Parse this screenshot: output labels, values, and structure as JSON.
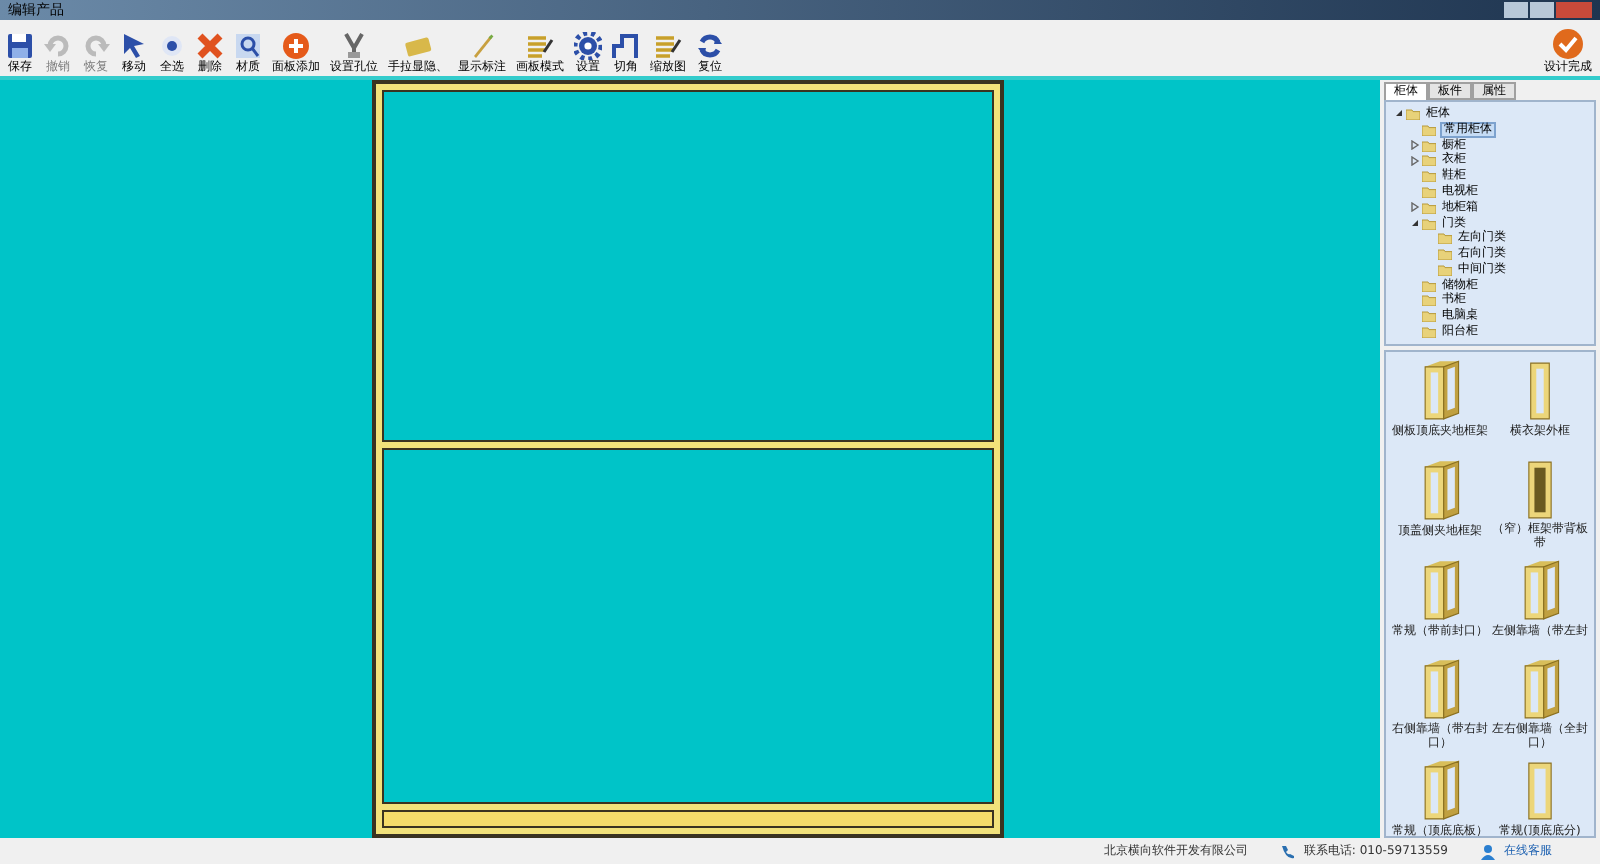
{
  "window": {
    "title": "编辑产品"
  },
  "toolbar": [
    {
      "label": "保存",
      "disabled": false,
      "kind": "save"
    },
    {
      "label": "撤销",
      "disabled": true,
      "kind": "undo"
    },
    {
      "label": "恢复",
      "disabled": true,
      "kind": "redo"
    },
    {
      "label": "移动",
      "disabled": false,
      "kind": "cursor"
    },
    {
      "label": "全选",
      "disabled": false,
      "kind": "dot"
    },
    {
      "label": "删除",
      "disabled": false,
      "kind": "delete"
    },
    {
      "label": "材质",
      "disabled": false,
      "kind": "material"
    },
    {
      "label": "面板添加",
      "disabled": false,
      "kind": "add"
    },
    {
      "label": "设置孔位",
      "disabled": false,
      "kind": "tools"
    },
    {
      "label": "手拉显隐、",
      "disabled": false,
      "kind": "handle"
    },
    {
      "label": "显示标注",
      "disabled": false,
      "kind": "pen"
    },
    {
      "label": "画板模式",
      "disabled": false,
      "kind": "lines"
    },
    {
      "label": "设置",
      "disabled": false,
      "kind": "gear"
    },
    {
      "label": "切角",
      "disabled": false,
      "kind": "step"
    },
    {
      "label": "缩放图",
      "disabled": false,
      "kind": "lines"
    },
    {
      "label": "复位",
      "disabled": false,
      "kind": "reset"
    }
  ],
  "finish_button": {
    "label": "设计完成"
  },
  "panel": {
    "tabs": [
      {
        "label": "柜体",
        "selected": true
      },
      {
        "label": "板件",
        "selected": false
      },
      {
        "label": "属性",
        "selected": false
      }
    ],
    "tree": [
      {
        "label": "柜体",
        "expanded": true,
        "selected": false,
        "children": [
          {
            "label": "常用柜体",
            "selected": true
          },
          {
            "label": "橱柜",
            "expanded": false,
            "selected": false
          },
          {
            "label": "衣柜",
            "expanded": false,
            "selected": false
          },
          {
            "label": "鞋柜",
            "selected": false
          },
          {
            "label": "电视柜",
            "selected": false
          },
          {
            "label": "地柜箱",
            "expanded": false,
            "selected": false
          },
          {
            "label": "门类",
            "expanded": true,
            "selected": false,
            "children": [
              {
                "label": "左向门类",
                "selected": false
              },
              {
                "label": "右向门类",
                "selected": false
              },
              {
                "label": "中间门类",
                "selected": false
              }
            ]
          },
          {
            "label": "储物柜",
            "selected": false
          },
          {
            "label": "书柜",
            "selected": false
          },
          {
            "label": "电脑桌",
            "selected": false
          },
          {
            "label": "阳台柜",
            "selected": false
          }
        ]
      }
    ],
    "gallery": [
      {
        "label": "侧板顶底夹地框架",
        "kind": "frame"
      },
      {
        "label": "横衣架外框",
        "kind": "tall"
      },
      {
        "label": "顶盖侧夹地框架",
        "kind": "frame"
      },
      {
        "label": "（窄）框架带背板带",
        "kind": "back"
      },
      {
        "label": "常规（带前封口）",
        "kind": "frame"
      },
      {
        "label": "左侧靠墙（带左封",
        "kind": "frame"
      },
      {
        "label": "右侧靠墙（带右封口）",
        "kind": "frame"
      },
      {
        "label": "左右侧靠墙（全封口）",
        "kind": "frame"
      },
      {
        "label": "常规（顶底底板）",
        "kind": "frame"
      },
      {
        "label": "常规(顶底底分)",
        "kind": "open"
      }
    ]
  },
  "status_bar": {
    "company": "北京横向软件开发有限公司",
    "phone": "联系电话: 010-59713559",
    "support": "在线客服"
  }
}
